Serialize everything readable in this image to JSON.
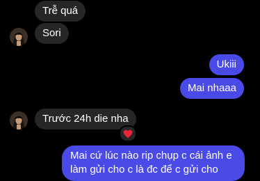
{
  "thread": {
    "messages": [
      {
        "id": "m1",
        "direction": "incoming",
        "text": "Trễ quá"
      },
      {
        "id": "m2",
        "direction": "incoming",
        "text": "Sori"
      },
      {
        "id": "m3",
        "direction": "outgoing",
        "text": "Ukiii"
      },
      {
        "id": "m4",
        "direction": "outgoing",
        "text": "Mai nhaaa"
      },
      {
        "id": "m5",
        "direction": "incoming",
        "text": "Trước 24h die nha",
        "reaction": "heart-icon"
      },
      {
        "id": "m6",
        "direction": "outgoing",
        "text": "Mai cứ lúc nào rip chụp c cái ảnh e làm gửi cho c là đc để c gửi cho"
      }
    ]
  },
  "colors": {
    "background": "#000000",
    "incoming_bubble": "#262626",
    "outgoing_bubble": "#4a4ae6",
    "text": "#ffffff",
    "reaction_heart": "#e8263c"
  }
}
